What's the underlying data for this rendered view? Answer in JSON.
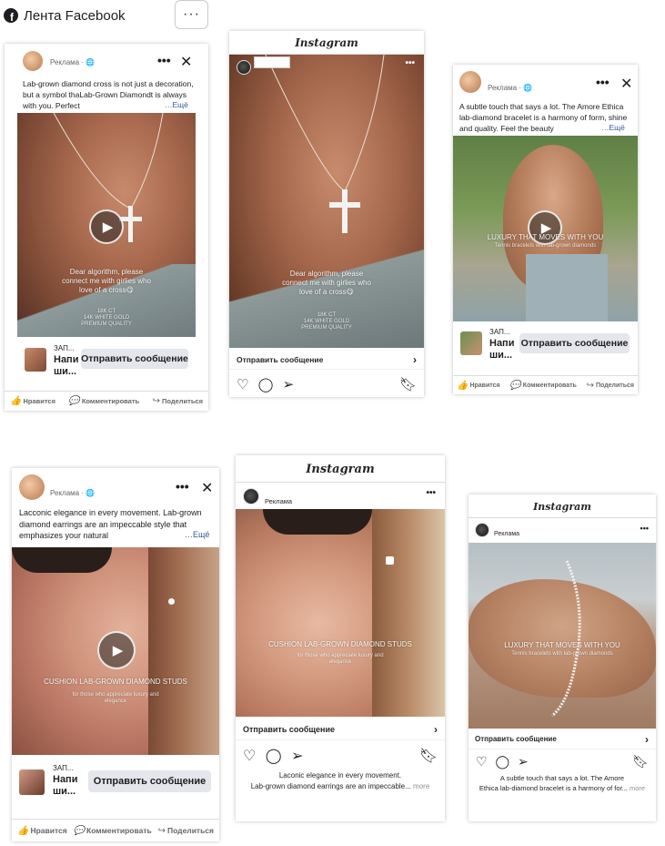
{
  "header": {
    "fb_logo": "f",
    "title": "Лента Facebook",
    "more_button": "···"
  },
  "colors": {
    "cta_bg": "#e4e6eb",
    "link": "#385898",
    "secondary_text": "#65676b"
  },
  "fb": {
    "sponsored": "Реклама",
    "globe_icon": "🌐",
    "more": "…Ещё",
    "cta": "Отправить сообщение",
    "like": "Нравится",
    "comment": "Комментировать",
    "share": "Поделиться",
    "cta_label_small": "ЗАП...",
    "cta_label_big1": "Напи",
    "cta_label_big2": "ши..."
  },
  "ig": {
    "logo": "Instagram",
    "sponsored": "Реклама",
    "cta": "Отправить сообщение",
    "more": "more"
  },
  "card1": {
    "caption": "Lab-grown diamond cross is not just a decoration, but a symbol thaLab-Grown Diamondt is always with you. Perfect",
    "overlay_text": "Dear algorithm, please connect me with girlies who love of a cross😋",
    "overlay_small": "18K CT\n14K WHITE GOLD\nPREMIUM QUALITY"
  },
  "card2": {
    "overlay_text": "Dear algorithm, please connect me with girlies who love of a cross😋",
    "overlay_small": "18K CT\n14K WHITE GOLD\nPREMIUM QUALITY"
  },
  "card3": {
    "caption": "A subtle touch that says a lot. The Amore Ethica lab-diamond bracelet is a harmony of form, shine and quality. Feel the beauty",
    "overlay_text": "LUXURY THAT MOVES WITH YOU",
    "overlay_small": "Tennis bracelets with lab-grown diamonds"
  },
  "card4": {
    "caption": "Lacconic elegance in every movement. Lab-grown diamond earrings are an impeccable style that emphasizes your natural",
    "overlay_text": "CUSHION LAB-GROWN DIAMOND STUDS",
    "overlay_small": "for those who appreciate luxury and elegance"
  },
  "card5": {
    "overlay_text": "CUSHION LAB-GROWN DIAMOND STUDS",
    "overlay_small": "for those who appreciate luxury and elegance",
    "caption1": "Laconic elegance in every movement.",
    "caption2": "Lab-grown diamond earrings are an impeccable..."
  },
  "card6": {
    "overlay_text": "LUXURY THAT MOVES WITH YOU",
    "overlay_small": "Tennis bracelets with lab-grown diamonds",
    "caption1": "A subtle touch that says a lot. The Amore",
    "caption2": "Ethica lab-diamond bracelet is a harmony of for..."
  }
}
